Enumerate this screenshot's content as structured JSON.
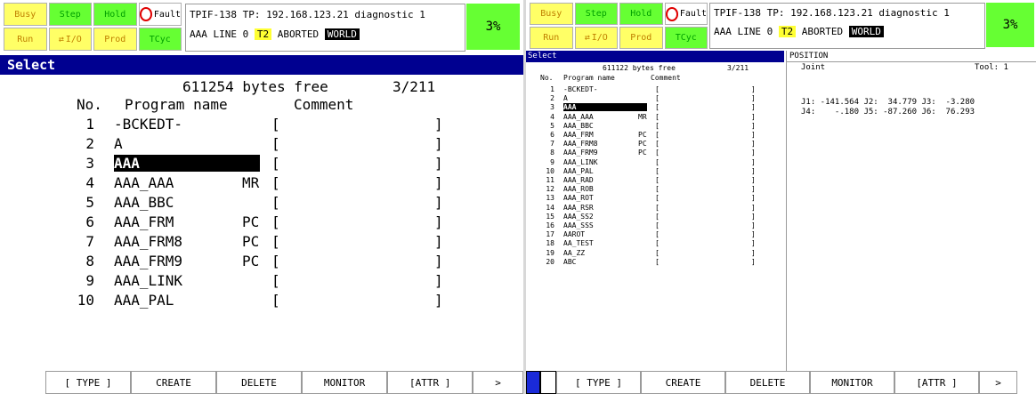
{
  "status": {
    "lamps_row1": [
      "Busy",
      "Step",
      "Hold",
      "Fault"
    ],
    "lamps_row2": [
      "Run",
      "I/O",
      "Prod",
      "TCyc"
    ],
    "message_line1": "TPIF-138 TP: 192.168.123.21 diagnostic 1",
    "line_label": "AAA LINE 0",
    "t2": "T2",
    "aborted": "ABORTED",
    "world": "WORLD",
    "percent": "3%"
  },
  "left": {
    "title": "Select",
    "bytes_free": "611254 bytes free",
    "count": "3/211",
    "col_no": "No.",
    "col_name": "Program name",
    "col_comment": "Comment",
    "rows": [
      {
        "no": "1",
        "name": "-BCKEDT-",
        "attr": ""
      },
      {
        "no": "2",
        "name": "A",
        "attr": ""
      },
      {
        "no": "3",
        "name": "AAA",
        "attr": "",
        "selected": true
      },
      {
        "no": "4",
        "name": "AAA_AAA",
        "attr": "MR"
      },
      {
        "no": "5",
        "name": "AAA_BBC",
        "attr": ""
      },
      {
        "no": "6",
        "name": "AAA_FRM",
        "attr": "PC"
      },
      {
        "no": "7",
        "name": "AAA_FRM8",
        "attr": "PC"
      },
      {
        "no": "8",
        "name": "AAA_FRM9",
        "attr": "PC"
      },
      {
        "no": "9",
        "name": "AAA_LINK",
        "attr": ""
      },
      {
        "no": "10",
        "name": "AAA_PAL",
        "attr": ""
      }
    ],
    "fkeys": [
      "[ TYPE ]",
      "CREATE",
      "DELETE",
      "MONITOR",
      "[ATTR ]",
      ">"
    ]
  },
  "right": {
    "title": "Select",
    "bytes_free": "611122 bytes free",
    "count": "3/211",
    "col_no": "No.",
    "col_name": "Program name",
    "col_comment": "Comment",
    "rows": [
      {
        "no": "1",
        "name": "-BCKEDT-",
        "attr": ""
      },
      {
        "no": "2",
        "name": "A",
        "attr": ""
      },
      {
        "no": "3",
        "name": "AAA",
        "attr": "",
        "selected": true
      },
      {
        "no": "4",
        "name": "AAA_AAA",
        "attr": "MR"
      },
      {
        "no": "5",
        "name": "AAA_BBC",
        "attr": ""
      },
      {
        "no": "6",
        "name": "AAA_FRM",
        "attr": "PC"
      },
      {
        "no": "7",
        "name": "AAA_FRM8",
        "attr": "PC"
      },
      {
        "no": "8",
        "name": "AAA_FRM9",
        "attr": "PC"
      },
      {
        "no": "9",
        "name": "AAA_LINK",
        "attr": ""
      },
      {
        "no": "10",
        "name": "AAA_PAL",
        "attr": ""
      },
      {
        "no": "11",
        "name": "AAA_RAD",
        "attr": ""
      },
      {
        "no": "12",
        "name": "AAA_ROB",
        "attr": ""
      },
      {
        "no": "13",
        "name": "AAA_ROT",
        "attr": ""
      },
      {
        "no": "14",
        "name": "AAA_RSR",
        "attr": ""
      },
      {
        "no": "15",
        "name": "AAA_SS2",
        "attr": ""
      },
      {
        "no": "16",
        "name": "AAA_SSS",
        "attr": ""
      },
      {
        "no": "17",
        "name": "AAROT",
        "attr": ""
      },
      {
        "no": "18",
        "name": "AA_TEST",
        "attr": ""
      },
      {
        "no": "19",
        "name": "AA_ZZ",
        "attr": ""
      },
      {
        "no": "20",
        "name": "ABC",
        "attr": ""
      }
    ],
    "position": {
      "title": "POSITION",
      "mode": "Joint",
      "tool": "Tool: 1",
      "joint_line1": "J1: -141.564 J2:  34.779 J3:  -3.280",
      "joint_line2": "J4:    -.180 J5: -87.260 J6:  76.293"
    },
    "fkeys": [
      "[ TYPE ]",
      "CREATE",
      "DELETE",
      "MONITOR",
      "[ATTR ]",
      ">"
    ]
  },
  "colors": {
    "titlebar": "#000090",
    "lamp_yellow": "#ffff66",
    "lamp_green": "#66ff33",
    "selection": "#000000"
  }
}
